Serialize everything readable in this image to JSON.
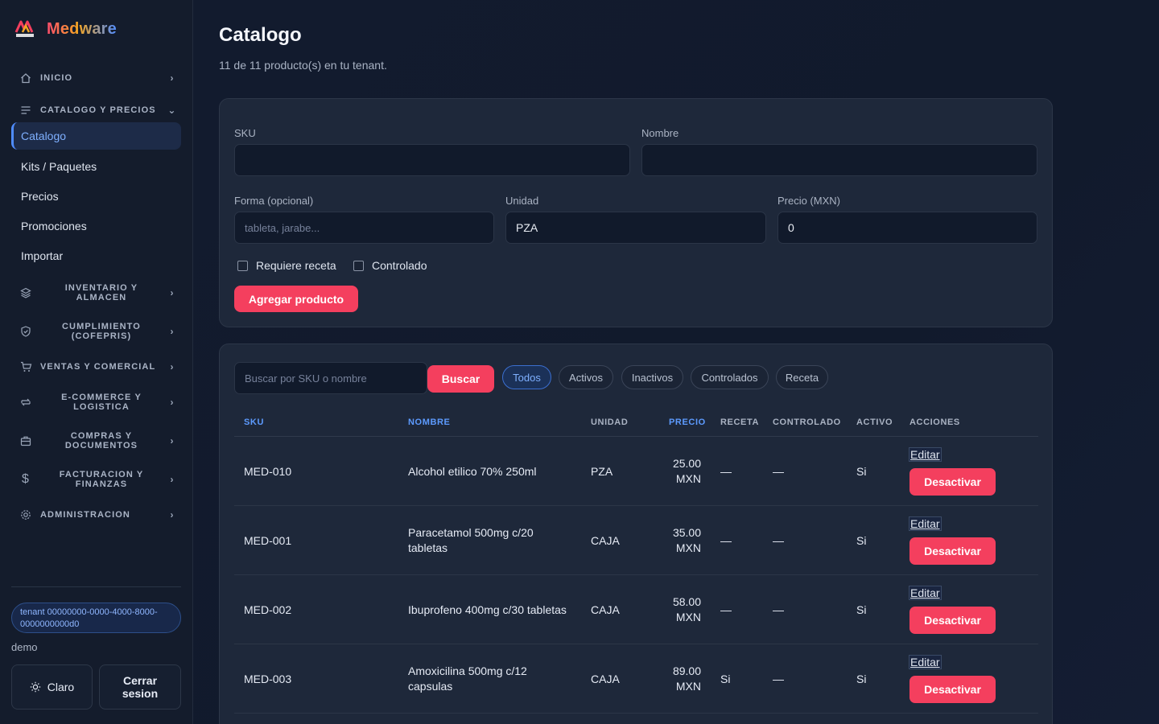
{
  "brand": {
    "name": "Medware",
    "logo_text": "MEDWARE"
  },
  "colors": {
    "accent": "#f43f5e",
    "link": "#4f8cff",
    "sidebar_bg": "#141c2c",
    "card_bg": "#1e283a"
  },
  "sidebar": {
    "groups": [
      {
        "label": "INICIO",
        "icon": "home-icon",
        "expanded": false
      },
      {
        "label": "CATALOGO Y PRECIOS",
        "icon": "list-icon",
        "expanded": true
      },
      {
        "label": "INVENTARIO Y ALMACEN",
        "icon": "layers-icon",
        "expanded": false
      },
      {
        "label": "CUMPLIMIENTO (COFEPRIS)",
        "icon": "shield-icon",
        "expanded": false
      },
      {
        "label": "VENTAS Y COMERCIAL",
        "icon": "cart-icon",
        "expanded": false
      },
      {
        "label": "E-COMMERCE Y LOGISTICA",
        "icon": "repeat-icon",
        "expanded": false
      },
      {
        "label": "COMPRAS Y DOCUMENTOS",
        "icon": "briefcase-icon",
        "expanded": false
      },
      {
        "label": "FACTURACION Y FINANZAS",
        "icon": "dollar-icon",
        "expanded": false
      },
      {
        "label": "ADMINISTRACION",
        "icon": "gear-icon",
        "expanded": false
      }
    ],
    "catalog_items": [
      "Catalogo",
      "Kits / Paquetes",
      "Precios",
      "Promociones",
      "Importar"
    ],
    "active_item": "Catalogo",
    "tenant": "tenant 00000000-0000-4000-8000-0000000000d0",
    "user": "demo",
    "theme_button": "Claro",
    "logout_button": "Cerrar sesion"
  },
  "page": {
    "title": "Catalogo",
    "subtitle": "11 de 11 producto(s) en tu tenant."
  },
  "form": {
    "sku_label": "SKU",
    "sku_value": "",
    "name_label": "Nombre",
    "name_value": "",
    "form_label": "Forma (opcional)",
    "form_placeholder": "tableta, jarabe...",
    "unit_label": "Unidad",
    "unit_value": "PZA",
    "price_label": "Precio (MXN)",
    "price_value": "0",
    "requires_prescription_label": "Requiere receta",
    "requires_prescription": false,
    "controlled_label": "Controlado",
    "controlled": false,
    "submit_label": "Agregar producto"
  },
  "filters": {
    "search_placeholder": "Buscar por SKU o nombre",
    "search_button": "Buscar",
    "chips": [
      {
        "label": "Todos",
        "active": true
      },
      {
        "label": "Activos",
        "active": false
      },
      {
        "label": "Inactivos",
        "active": false
      },
      {
        "label": "Controlados",
        "active": false
      },
      {
        "label": "Receta",
        "active": false
      }
    ]
  },
  "table": {
    "columns": [
      "SKU",
      "NOMBRE",
      "UNIDAD",
      "PRECIO",
      "RECETA",
      "CONTROLADO",
      "ACTIVO",
      "ACCIONES"
    ],
    "sorted_columns": [
      "SKU",
      "NOMBRE",
      "PRECIO"
    ],
    "edit_label": "Editar",
    "deactivate_label": "Desactivar",
    "rows": [
      {
        "sku": "MED-010",
        "name": "Alcohol etilico 70% 250ml",
        "unit": "PZA",
        "price": "25.00",
        "currency": "MXN",
        "receta": "—",
        "controlado": "—",
        "activo": "Si"
      },
      {
        "sku": "MED-001",
        "name": "Paracetamol 500mg c/20 tabletas",
        "unit": "CAJA",
        "price": "35.00",
        "currency": "MXN",
        "receta": "—",
        "controlado": "—",
        "activo": "Si"
      },
      {
        "sku": "MED-002",
        "name": "Ibuprofeno 400mg c/30 tabletas",
        "unit": "CAJA",
        "price": "58.00",
        "currency": "MXN",
        "receta": "—",
        "controlado": "—",
        "activo": "Si"
      },
      {
        "sku": "MED-003",
        "name": "Amoxicilina 500mg c/12 capsulas",
        "unit": "CAJA",
        "price": "89.00",
        "currency": "MXN",
        "receta": "Si",
        "controlado": "—",
        "activo": "Si"
      }
    ]
  }
}
